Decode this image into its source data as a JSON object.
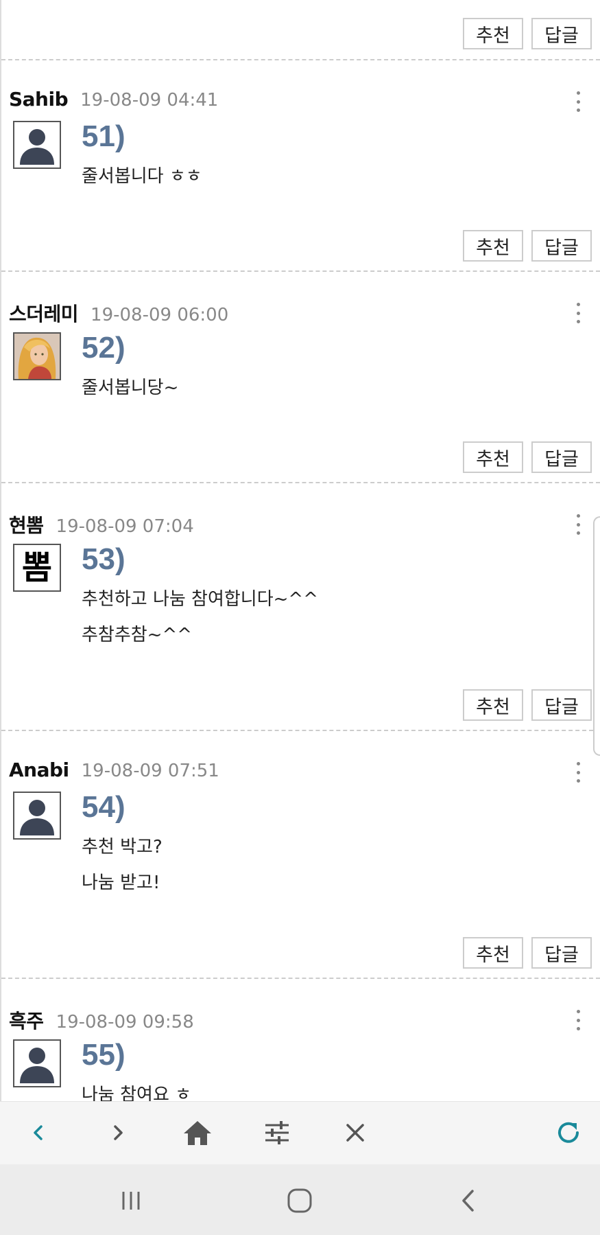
{
  "labels": {
    "recommend": "추천",
    "reply": "답글"
  },
  "comments": [
    {
      "author": "Sahib",
      "time": "19-08-09 04:41",
      "avatar": "default-user-icon",
      "num": "51)",
      "lines": [
        "줄서봅니다 ㅎㅎ"
      ]
    },
    {
      "author": "스더레미",
      "time": "19-08-09 06:00",
      "avatar": "anime-character-avatar",
      "num": "52)",
      "lines": [
        "줄서봅니당~"
      ]
    },
    {
      "author": "현뽐",
      "time": "19-08-09 07:04",
      "avatar": "text-avatar",
      "avatar_text": "뽐",
      "num": "53)",
      "lines": [
        "추천하고 나눔 참여합니다~^^",
        "추참추참~^^"
      ]
    },
    {
      "author": "Anabi",
      "time": "19-08-09 07:51",
      "avatar": "default-user-icon",
      "num": "54)",
      "lines": [
        "추천 박고?",
        "나눔 받고!"
      ]
    },
    {
      "author": "흑주",
      "time": "19-08-09 09:58",
      "avatar": "default-user-icon",
      "num": "55)",
      "lines": [
        "나눔 참여요 ㅎ"
      ]
    }
  ],
  "toolbar": {
    "icons": [
      "back-icon",
      "forward-icon",
      "home-icon",
      "settings-sliders-icon",
      "close-icon",
      "refresh-icon"
    ],
    "accent": "#1a8a9a"
  },
  "navbar": {
    "icons": [
      "recent-apps-icon",
      "home-circle-icon",
      "back-chevron-icon"
    ]
  }
}
